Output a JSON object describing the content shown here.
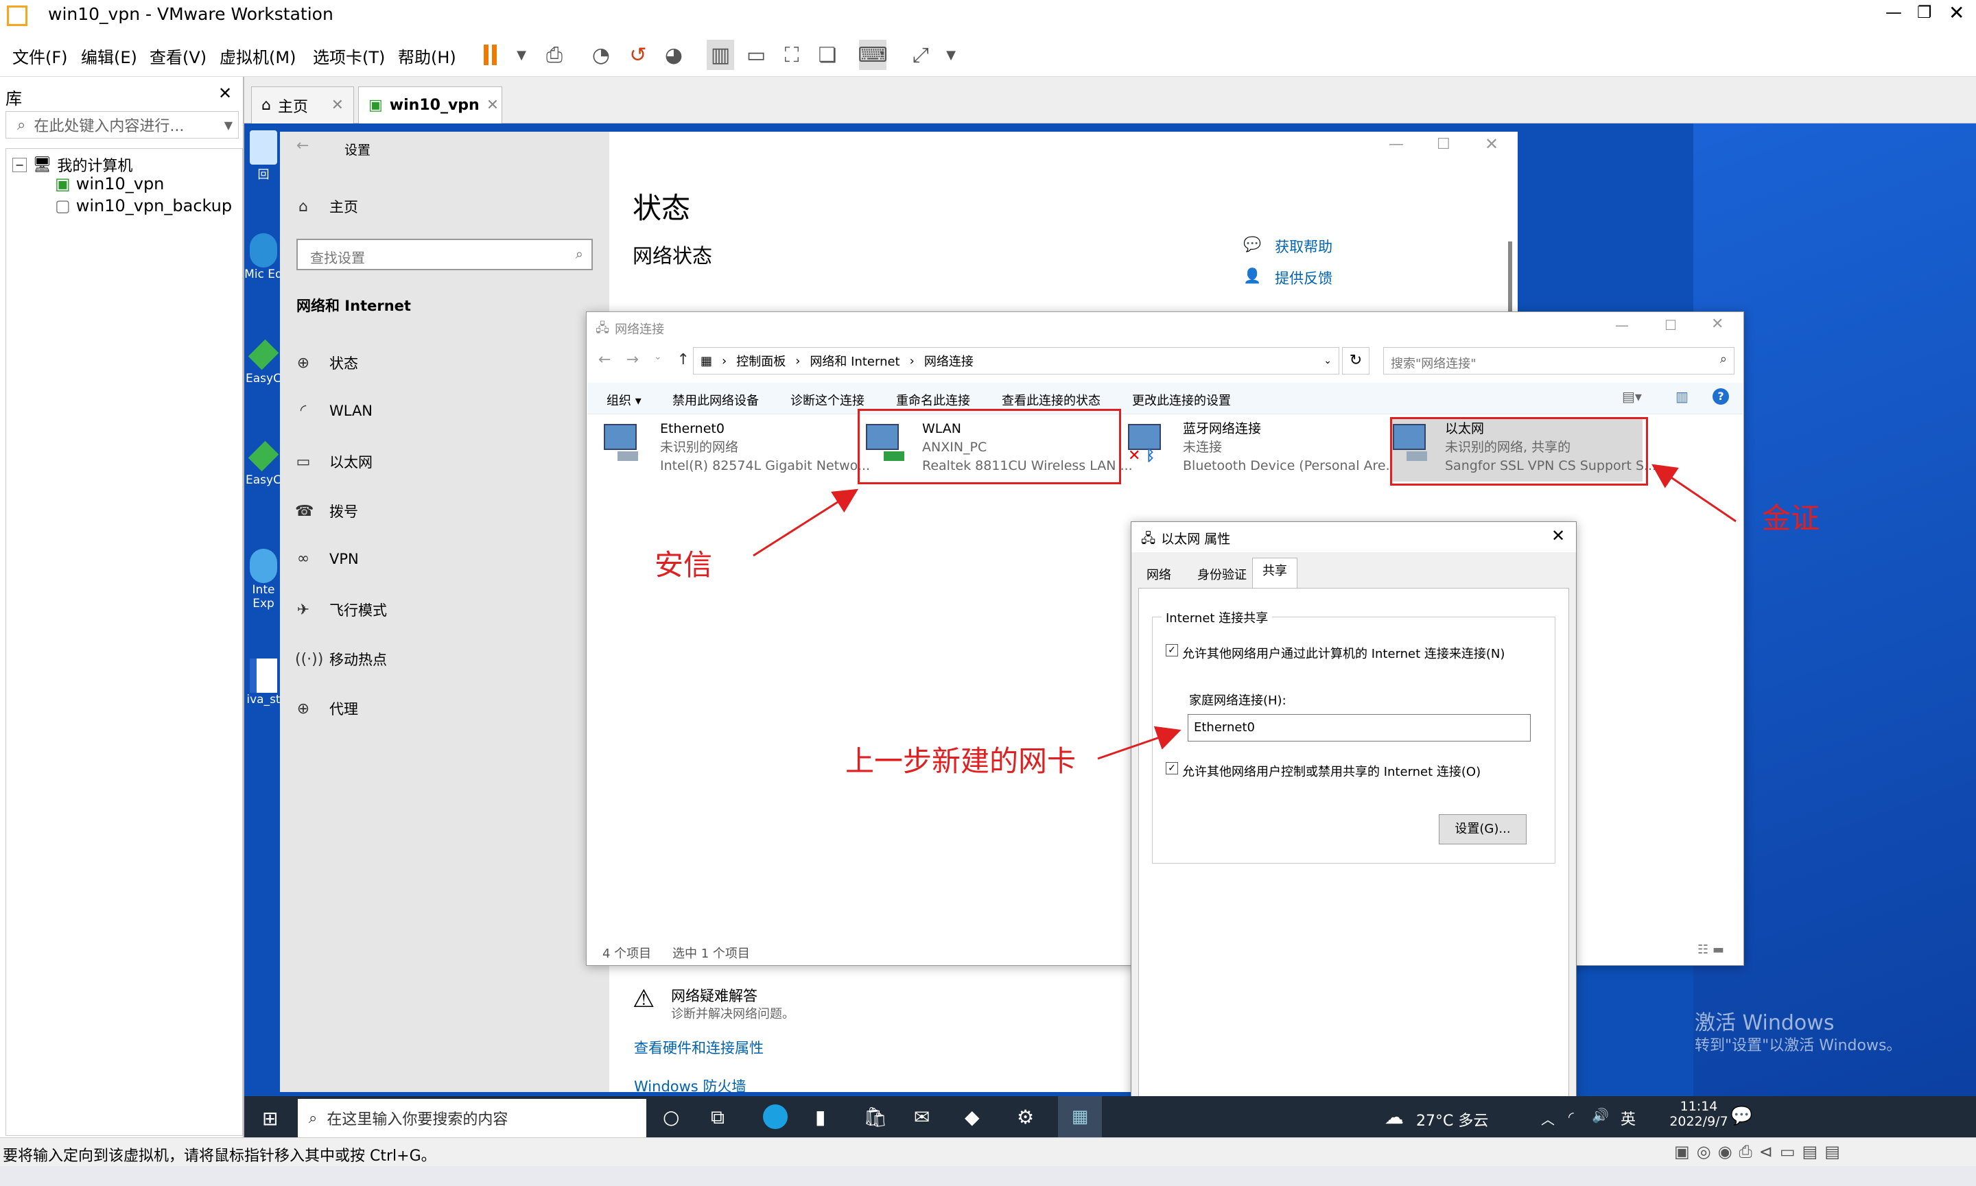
{
  "window": {
    "title": "win10_vpn - VMware Workstation"
  },
  "menu": [
    "文件(F)",
    "编辑(E)",
    "查看(V)",
    "虚拟机(M)",
    "选项卡(T)",
    "帮助(H)"
  ],
  "library": {
    "title": "库",
    "search_placeholder": "在此处键入内容进行...",
    "root": "我的计算机",
    "vms": [
      "win10_vpn",
      "win10_vpn_backup"
    ]
  },
  "vm_tabs": {
    "home": "主页",
    "active": "win10_vpn"
  },
  "desktop_icons": [
    "回",
    "Mic\nEd",
    "EasyC",
    "EasyC",
    "Inte\nExp",
    "iva_st"
  ],
  "settings": {
    "title": "设置",
    "home": "主页",
    "search_placeholder": "查找设置",
    "section": "网络和 Internet",
    "nav": [
      {
        "icon": "home-icon",
        "label": "状态"
      },
      {
        "icon": "wlan-icon",
        "label": "WLAN"
      },
      {
        "icon": "ethernet-icon",
        "label": "以太网"
      },
      {
        "icon": "dialup-icon",
        "label": "拨号"
      },
      {
        "icon": "vpn-icon",
        "label": "VPN"
      },
      {
        "icon": "airplane-icon",
        "label": "飞行模式"
      },
      {
        "icon": "hotspot-icon",
        "label": "移动热点"
      },
      {
        "icon": "proxy-icon",
        "label": "代理"
      }
    ],
    "page_title": "状态",
    "page_subtitle": "网络状态",
    "help": "获取帮助",
    "feedback": "提供反馈",
    "troubleshoot_title": "网络疑难解答",
    "troubleshoot_sub": "诊断并解决网络问题。",
    "link_hw": "查看硬件和连接属性",
    "link_fw": "Windows 防火墙"
  },
  "netconn": {
    "title": "网络连接",
    "breadcrumb": [
      "控制面板",
      "网络和 Internet",
      "网络连接"
    ],
    "search_placeholder": "搜索\"网络连接\"",
    "toolbar": [
      "组织 ▾",
      "禁用此网络设备",
      "诊断这个连接",
      "重命名此连接",
      "查看此连接的状态",
      "更改此连接的设置"
    ],
    "adapters": [
      {
        "name": "Ethernet0",
        "status": "未识别的网络",
        "device": "Intel(R) 82574L Gigabit Netwo..."
      },
      {
        "name": "WLAN",
        "status": "ANXIN_PC",
        "device": "Realtek 8811CU Wireless LAN ..."
      },
      {
        "name": "蓝牙网络连接",
        "status": "未连接",
        "device": "Bluetooth Device (Personal Are..."
      },
      {
        "name": "以太网",
        "status": "未识别的网络, 共享的",
        "device": "Sangfor SSL VPN CS Support S..."
      }
    ],
    "count": "4 个项目",
    "selected": "选中 1 个项目"
  },
  "props": {
    "title": "以太网 属性",
    "tabs": [
      "网络",
      "身份验证",
      "共享"
    ],
    "group": "Internet 连接共享",
    "check1": "允许其他网络用户通过此计算机的 Internet 连接来连接(N)",
    "home_label": "家庭网络连接(H):",
    "home_value": "Ethernet0",
    "check2": "允许其他网络用户控制或禁用共享的 Internet 连接(O)",
    "settings_btn": "设置(G)..."
  },
  "annotations": {
    "anxin": "安信",
    "jinzheng": "金证",
    "newnic": "上一步新建的网卡"
  },
  "watermark": {
    "line1": "激活 Windows",
    "line2": "转到\"设置\"以激活 Windows。"
  },
  "taskbar": {
    "search": "在这里输入你要搜索的内容",
    "weather": "27°C 多云",
    "ime": "英",
    "time": "11:14",
    "date": "2022/9/7"
  },
  "statusbar": "要将输入定向到该虚拟机，请将鼠标指针移入其中或按 Ctrl+G。",
  "colors": {
    "accent": "#0063b1",
    "desktop": "#0d4fb6",
    "annotation": "#e02020"
  }
}
